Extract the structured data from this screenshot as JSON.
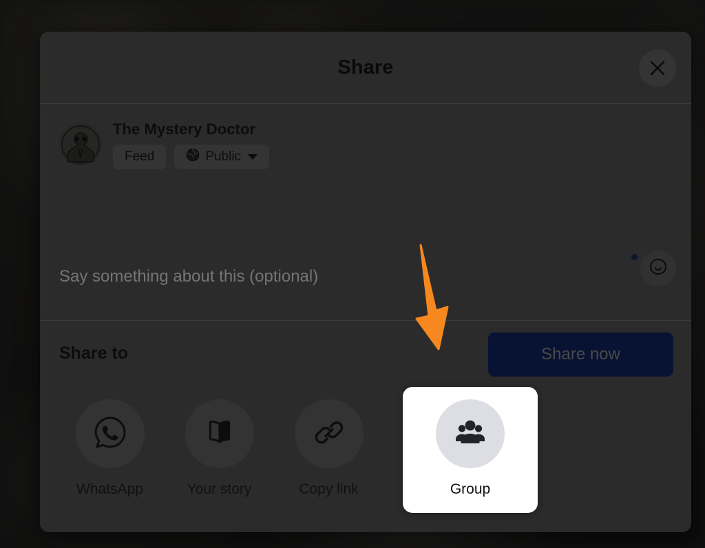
{
  "backdrop": {
    "description": "blurred dark photo background"
  },
  "modal": {
    "title": "Share",
    "close_icon": "close-icon",
    "composer": {
      "author_name": "The Mystery Doctor",
      "avatar_icon": "avatar-portrait-icon",
      "chips": [
        {
          "label": "Feed",
          "icon": null,
          "has_chevron": false
        },
        {
          "label": "Public",
          "icon": "globe-icon",
          "has_chevron": true
        }
      ],
      "input_placeholder": "Say something about this (optional)",
      "input_value": "",
      "emoji_icon": "emoji-smiley-icon",
      "share_now_label": "Share now"
    },
    "share_to": {
      "title": "Share to",
      "options": [
        {
          "label": "WhatsApp",
          "icon": "whatsapp-icon",
          "highlighted": false
        },
        {
          "label": "Your story",
          "icon": "book-icon",
          "highlighted": false
        },
        {
          "label": "Copy link",
          "icon": "link-icon",
          "highlighted": false
        },
        {
          "label": "Group",
          "icon": "group-people-icon",
          "highlighted": true
        }
      ]
    }
  },
  "annotation": {
    "type": "arrow",
    "color": "#f7881f",
    "points_to": "Group"
  },
  "colors": {
    "modal_background": "#2b2b2b",
    "share_now_button": "#081333",
    "highlight_card": "#ffffff",
    "highlight_icon_circle": "#dcdee3",
    "annotation_orange": "#f7881f"
  }
}
